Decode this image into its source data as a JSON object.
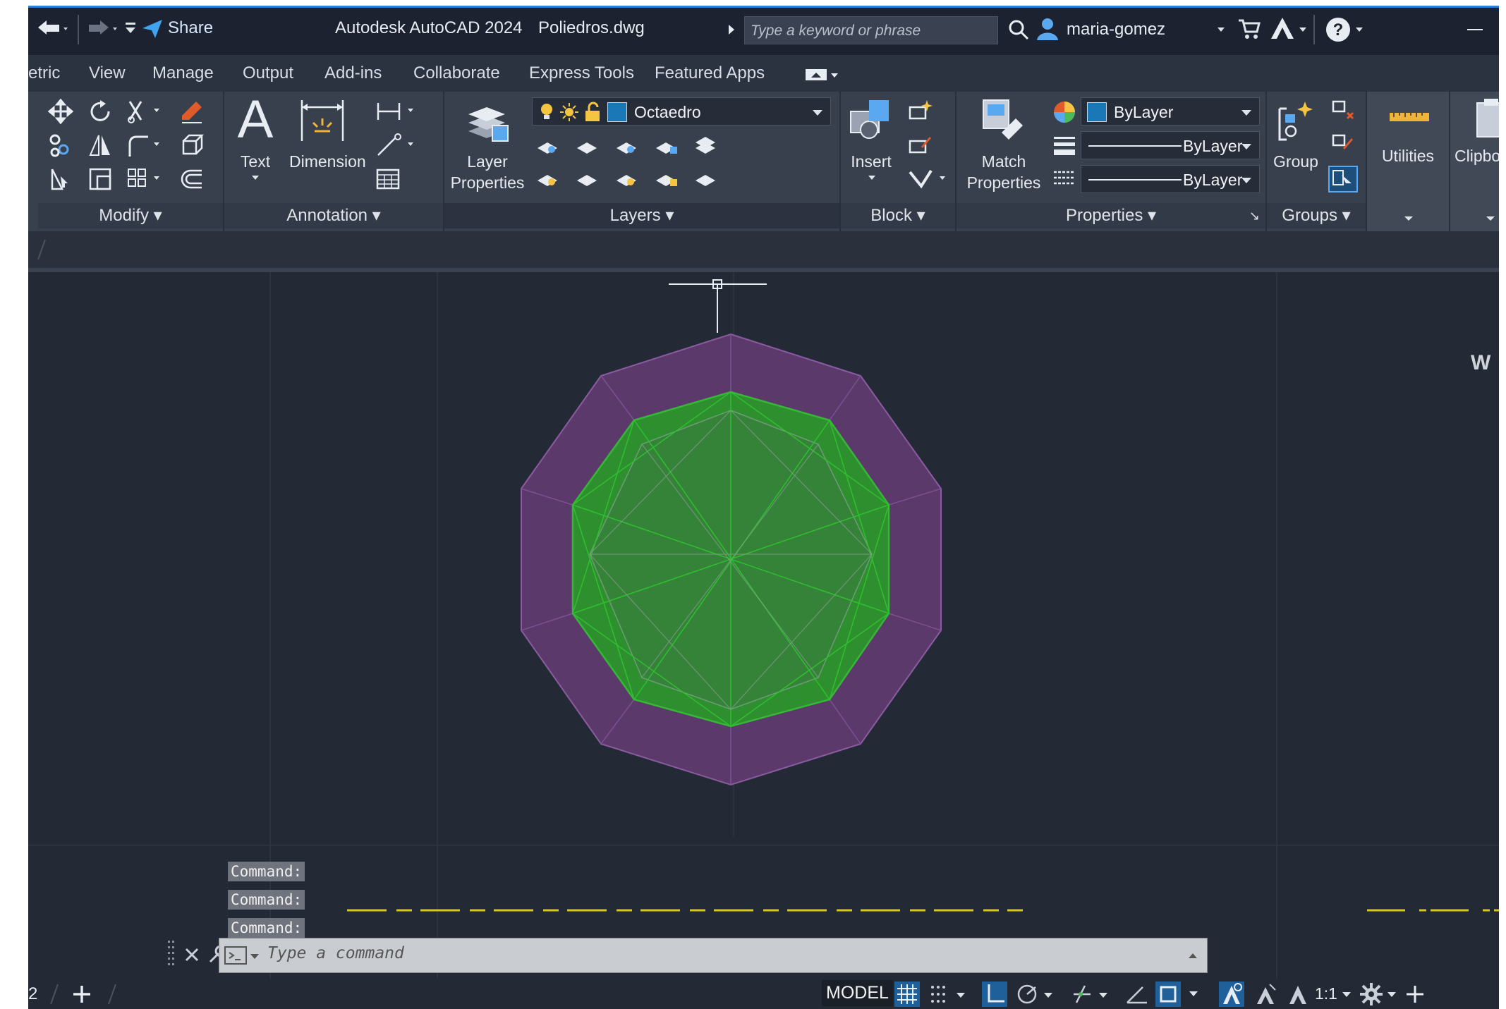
{
  "titlebar": {
    "share_label": "Share",
    "app_title": "Autodesk AutoCAD 2024",
    "file_name": "Poliedros.dwg",
    "search_placeholder": "Type a keyword or phrase",
    "user_name": "maria-gomez"
  },
  "menubar": {
    "items": [
      "etric",
      "View",
      "Manage",
      "Output",
      "Add-ins",
      "Collaborate",
      "Express Tools",
      "Featured Apps"
    ]
  },
  "ribbon": {
    "panels": {
      "modify": "Modify",
      "annotation": "Annotation",
      "layers": "Layers",
      "block": "Block",
      "properties": "Properties",
      "groups": "Groups"
    },
    "buttons": {
      "text": "Text",
      "dimension": "Dimension",
      "layer_properties_1": "Layer",
      "layer_properties_2": "Properties",
      "insert": "Insert",
      "match_properties_1": "Match",
      "match_properties_2": "Properties",
      "group": "Group",
      "utilities": "Utilities",
      "clipboard": "Clipbo"
    },
    "layer_combo": "Octaedro",
    "color_combo": "ByLayer",
    "linetype_combo": "ByLayer",
    "lineweight_combo": "ByLayer"
  },
  "command": {
    "history": [
      "Command:",
      "Command:",
      "Command:"
    ],
    "placeholder": "Type a command"
  },
  "statusbar": {
    "layout_tab_fragment": "2",
    "model_label": "MODEL",
    "scale_label": "1:1"
  },
  "colors": {
    "accent": "#2b7fd6",
    "outer_polyhedron": "#5b3a6b",
    "inner_polyhedron": "#2e8f2e",
    "dashed_line": "#d8c81a"
  }
}
